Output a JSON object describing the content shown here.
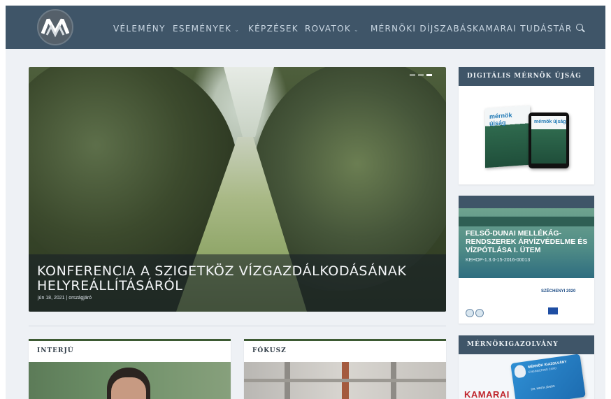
{
  "nav": {
    "items": [
      {
        "label": "VÉLEMÉNY"
      },
      {
        "label": "ESEMÉNYEK"
      },
      {
        "label": "KÉPZÉSEK"
      },
      {
        "label": "ROVATOK"
      },
      {
        "label": "MÉRNÖKI DÍJSZABÁS"
      },
      {
        "label": "KAMARAI TUDÁSTÁR"
      }
    ]
  },
  "hero": {
    "title": "KONFERENCIA A SZIGETKÖZ VÍZGAZDÁLKODÁSÁNAK HELYREÁLLÍTÁSÁRÓL",
    "date": "jún 18, 2021",
    "separator": "|",
    "category": "országjáró",
    "slider_count": 3,
    "slider_active": 3
  },
  "cards": [
    {
      "title": "INTERJÚ"
    },
    {
      "title": "FÓKUSZ"
    }
  ],
  "sidebar": {
    "magazine_title": "DIGITÁLIS MÉRNÖK ÚJSÁG",
    "magazine_logo": "mérnök újság",
    "ad_title": "FELSŐ-DUNAI MELLÉKÁG-RENDSZEREK ÁRVÍZVÉDELME ÉS VÍZPÓTLÁSA I. ÜTEM",
    "ad_code": "KEHOP-1.3.0-15-2016-00013",
    "ad_badge": "SZÉCHENYI 2020",
    "card_title": "MÉRNÖKIGAZOLVÁNY",
    "card_image_text": "KAMARAI",
    "id_card_text": "MÉRNÖK IGAZOLVÁNY",
    "id_card_subtext": "ENGINEERING CARD",
    "id_card_name": "DR. MINTA JÁNOS"
  },
  "colors": {
    "header_bg": "#3f5568",
    "accent_green": "#3d5a33",
    "page_bg": "#eef1f5"
  }
}
